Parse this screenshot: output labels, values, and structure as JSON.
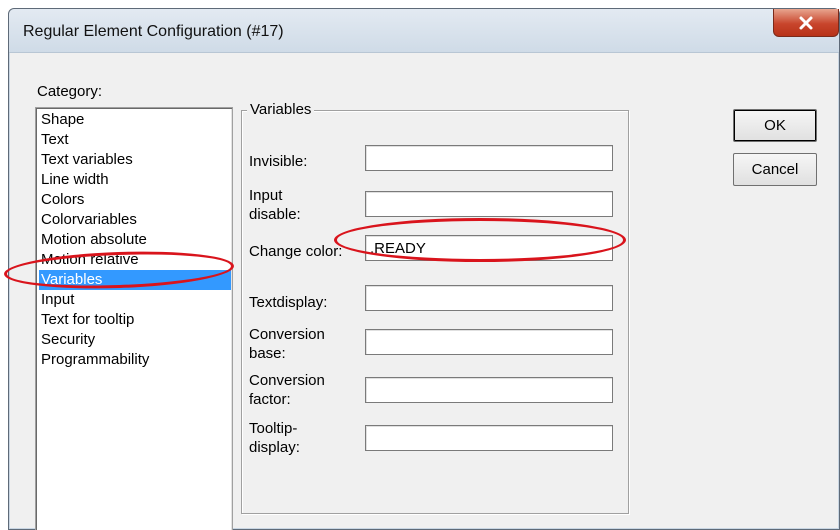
{
  "window": {
    "title": "Regular Element Configuration (#17)"
  },
  "category": {
    "label": "Category:",
    "items": [
      "Shape",
      "Text",
      "Text variables",
      "Line width",
      "Colors",
      "Colorvariables",
      "Motion absolute",
      "Motion relative",
      "Variables",
      "Input",
      "Text for tooltip",
      "Security",
      "Programmability"
    ],
    "selected": "Variables"
  },
  "variables": {
    "group_title": "Variables",
    "fields": [
      {
        "label": "Invisible:",
        "value": ""
      },
      {
        "label": "Input\ndisable:",
        "value": ""
      },
      {
        "label": "Change color:",
        "value": ".READY"
      },
      {
        "label": "Textdisplay:",
        "value": ""
      },
      {
        "label": "Conversion\nbase:",
        "value": ""
      },
      {
        "label": "Conversion\nfactor:",
        "value": ""
      },
      {
        "label": "Tooltip-\ndisplay:",
        "value": ""
      }
    ]
  },
  "buttons": {
    "ok": "OK",
    "cancel": "Cancel"
  },
  "colors": {
    "selection": "#3399ff",
    "annotation": "#d9141c",
    "close_button": "#c8452c"
  },
  "icons": {
    "close": "close-icon"
  }
}
